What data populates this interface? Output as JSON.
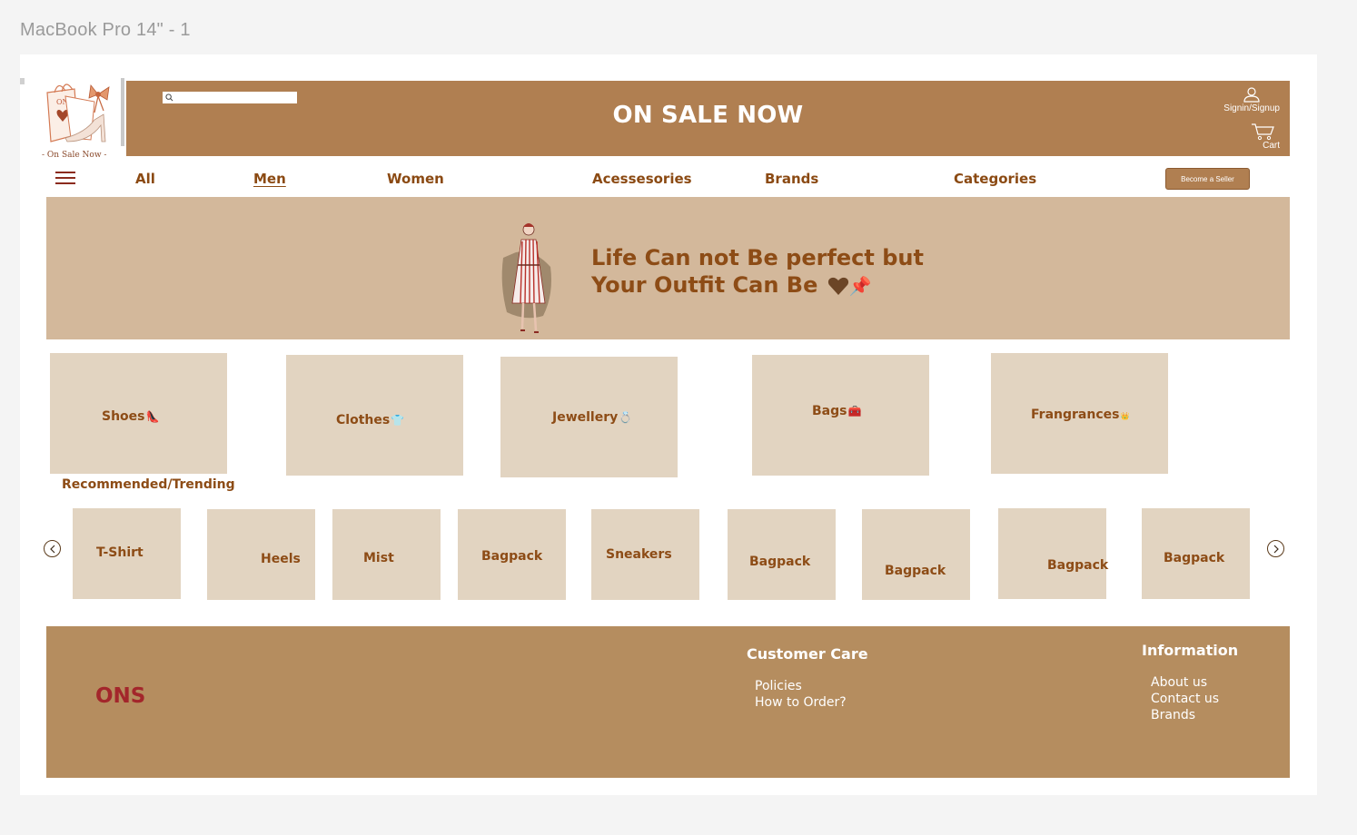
{
  "frame": {
    "title": "MacBook Pro 14\" - 1"
  },
  "logo": {
    "bag_text": "ONS",
    "caption": "- On Sale Now -"
  },
  "header": {
    "title": "ON SALE NOW",
    "search_placeholder": "",
    "signin_label": "Signin/Signup",
    "cart_label": "Cart",
    "color": "#b07f51"
  },
  "nav": {
    "items": [
      {
        "label": "All",
        "active": false
      },
      {
        "label": "Men",
        "active": true
      },
      {
        "label": "Women",
        "active": false
      },
      {
        "label": "Acessesories",
        "active": false
      },
      {
        "label": "Brands",
        "active": false
      },
      {
        "label": "Categories",
        "active": false
      }
    ],
    "seller_button": "Become a Seller"
  },
  "hero": {
    "line1": "Life Can not Be perfect but",
    "line2": "Your Outfit Can Be",
    "emojis": "📌",
    "color": "#d3b89b"
  },
  "categories": [
    {
      "label": "Shoes",
      "icon": "👠"
    },
    {
      "label": "Clothes",
      "icon": "👕"
    },
    {
      "label": "Jewellery",
      "icon": "💍"
    },
    {
      "label": "Bags",
      "icon": "🧰"
    },
    {
      "label": "Frangrances",
      "icon": "👑"
    }
  ],
  "trending": {
    "title": "Recommended/Trending",
    "items": [
      "T-Shirt",
      "Heels",
      "Mist",
      "Bagpack",
      "Sneakers",
      "Bagpack",
      "Bagpack",
      "Bagpack",
      "Bagpack"
    ],
    "prev_icon": "chevron-left-icon",
    "next_icon": "chevron-right-icon"
  },
  "footer": {
    "brand": "ONS",
    "customer_care": {
      "title": "Customer Care",
      "links": [
        "Policies",
        "How to Order?"
      ]
    },
    "information": {
      "title": "Information",
      "links": [
        "About us",
        "Contact us",
        "Brands"
      ]
    },
    "color": "#b58d5f"
  }
}
